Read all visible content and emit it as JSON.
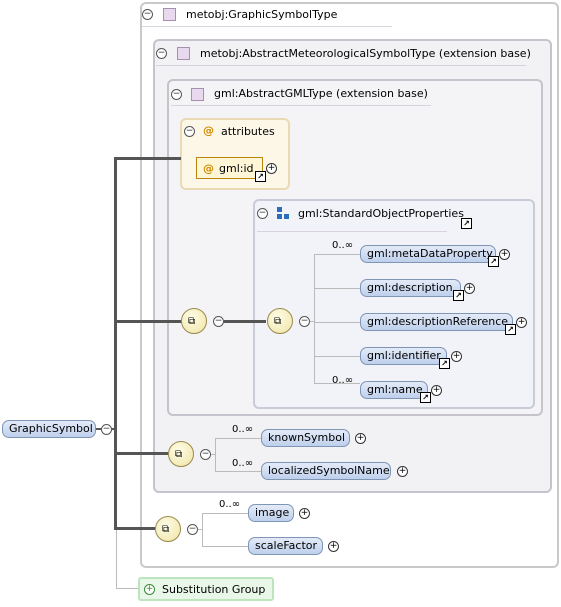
{
  "root": {
    "label": "GraphicSymbol"
  },
  "type_box": {
    "label": "metobj:GraphicSymbolType"
  },
  "ext_box1": {
    "label": "metobj:AbstractMeteorologicalSymbolType (extension base)"
  },
  "ext_box2": {
    "label": "gml:AbstractGMLType (extension base)"
  },
  "attributes": {
    "label": "attributes",
    "icon": "@",
    "items": [
      {
        "label": "gml:id"
      }
    ]
  },
  "standard_props": {
    "label": "gml:StandardObjectProperties",
    "elements": [
      {
        "label": "gml:metaDataProperty",
        "card": "0..∞"
      },
      {
        "label": "gml:description",
        "card": ""
      },
      {
        "label": "gml:descriptionReference",
        "card": ""
      },
      {
        "label": "gml:identifier",
        "card": ""
      },
      {
        "label": "gml:name",
        "card": "0..∞"
      }
    ]
  },
  "seq2": [
    {
      "label": "knownSymbol",
      "card": "0..∞"
    },
    {
      "label": "localizedSymbolName",
      "card": "0..∞"
    }
  ],
  "seq3": [
    {
      "label": "image",
      "card": "0..∞"
    },
    {
      "label": "scaleFactor",
      "card": ""
    }
  ],
  "substitution": {
    "label": "Substitution Group"
  }
}
